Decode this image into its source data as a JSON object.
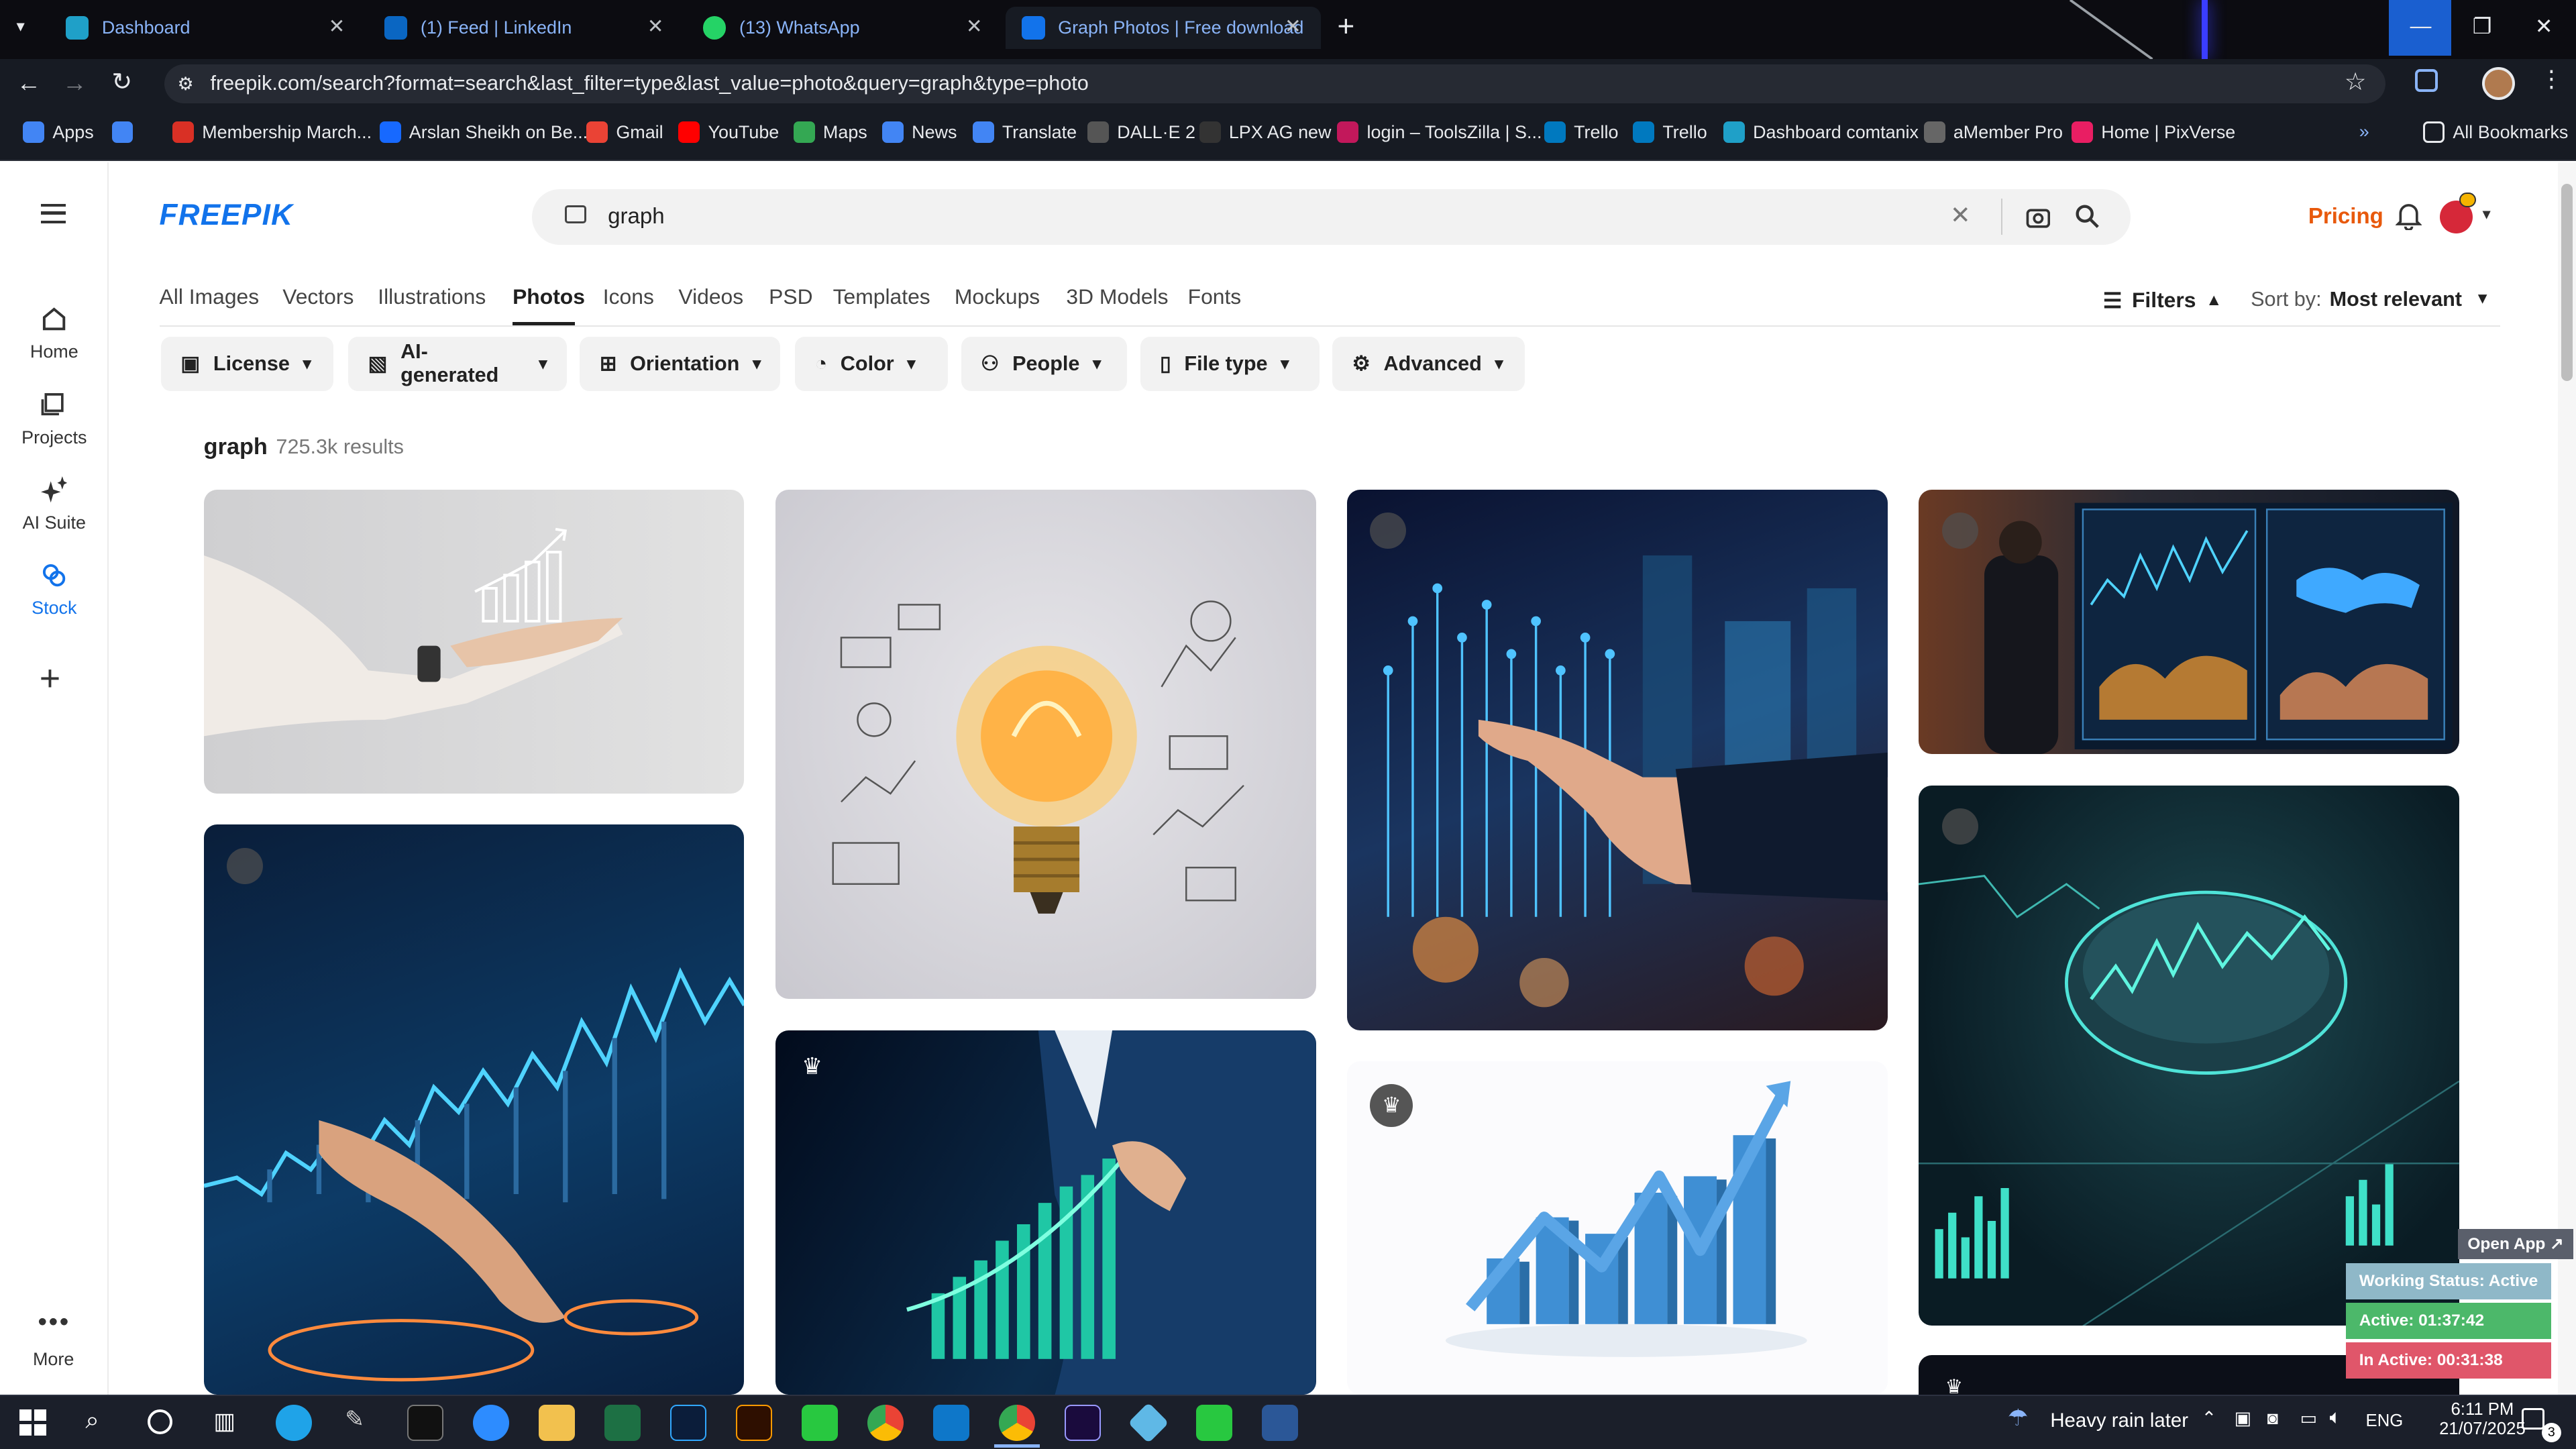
{
  "browser": {
    "tabs": [
      {
        "title": "Dashboard",
        "color": "#1fa0c8"
      },
      {
        "title": "(1) Feed | LinkedIn",
        "color": "#0a66c2"
      },
      {
        "title": "(13) WhatsApp",
        "color": "#25d366"
      },
      {
        "title": "Graph Photos | Free download",
        "color": "#1273eb"
      }
    ],
    "url": "freepik.com/search?format=search&last_filter=type&last_value=photo&query=graph&type=photo",
    "bookmarks": [
      {
        "label": "Apps",
        "color": "#4285f4"
      },
      {
        "label": "Membership March...",
        "color": "#d93025"
      },
      {
        "label": "Arslan Sheikh on Be...",
        "color": "#1769ff"
      },
      {
        "label": "Gmail",
        "color": "#ea4335"
      },
      {
        "label": "YouTube",
        "color": "#ff0000"
      },
      {
        "label": "Maps",
        "color": "#34a853"
      },
      {
        "label": "News",
        "color": "#4285f4"
      },
      {
        "label": "Translate",
        "color": "#4285f4"
      },
      {
        "label": "DALL·E 2",
        "color": "#555555"
      },
      {
        "label": "LPX AG new",
        "color": "#333333"
      },
      {
        "label": "login – ToolsZilla | S...",
        "color": "#c2185b"
      },
      {
        "label": "Trello",
        "color": "#0079bf"
      },
      {
        "label": "Trello",
        "color": "#0079bf"
      },
      {
        "label": "Dashboard comtanix",
        "color": "#1fa0c8"
      },
      {
        "label": "aMember Pro",
        "color": "#666666"
      },
      {
        "label": "Home | PixVerse",
        "color": "#e91e63"
      }
    ],
    "all_bookmarks": "All Bookmarks"
  },
  "sidebar": {
    "items": [
      {
        "label": "Home"
      },
      {
        "label": "Projects"
      },
      {
        "label": "AI Suite"
      },
      {
        "label": "Stock"
      }
    ],
    "more": "More"
  },
  "header": {
    "logo": "FREEPIK",
    "search_value": "graph",
    "pricing": "Pricing",
    "accent": "#1273eb",
    "pricing_color": "#e8590c"
  },
  "categories": [
    "All Images",
    "Vectors",
    "Illustrations",
    "Photos",
    "Icons",
    "Videos",
    "PSD",
    "Templates",
    "Mockups",
    "3D Models",
    "Fonts"
  ],
  "active_category": "Photos",
  "filters_label": "Filters",
  "sort": {
    "label": "Sort by:",
    "value": "Most relevant"
  },
  "filter_buttons": [
    "License",
    "AI-generated",
    "Orientation",
    "Color",
    "People",
    "File type",
    "Advanced"
  ],
  "results": {
    "query": "graph",
    "count": "725.3k results"
  },
  "status_widget": {
    "open_app": "Open App ↗",
    "working": "Working Status: Active",
    "active": "Active: 01:37:42",
    "inactive": "In Active: 00:31:38"
  },
  "taskbar": {
    "weather": "Heavy rain later",
    "lang": "ENG",
    "time": "6:11 PM",
    "date": "21/07/2025",
    "notif": "3"
  }
}
